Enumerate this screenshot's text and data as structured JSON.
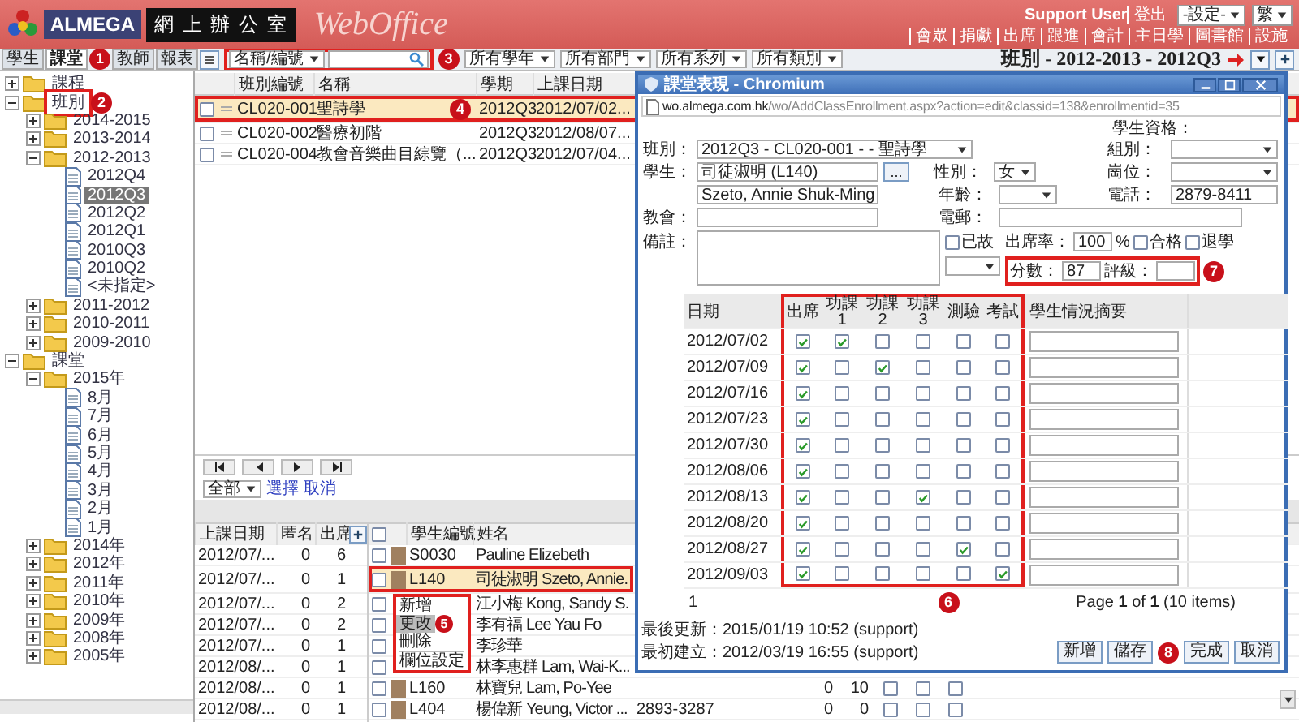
{
  "header": {
    "logo_text": "ALMEGA",
    "title": "網 上 辦 公 室",
    "product": "WebOffice",
    "user": "Support User",
    "logout": "登出",
    "nav": [
      "會眾",
      "捐獻",
      "出席",
      "跟進",
      "會計",
      "主日學",
      "圖書館",
      "設施"
    ],
    "settings_select": "-設定-",
    "language_select": "繁"
  },
  "tabs": [
    {
      "label": "學生",
      "selected": false
    },
    {
      "label": "課堂",
      "selected": true,
      "marker": {
        "number": "1",
        "boxed": false
      }
    },
    {
      "label": "教師",
      "selected": false
    },
    {
      "label": "報表",
      "selected": false
    }
  ],
  "toolbar": {
    "search_by": "名稱/編號",
    "search_marker": {
      "number": "3",
      "boxed": true
    },
    "filters": [
      "所有學年",
      "所有部門",
      "所有系列",
      "所有類別"
    ],
    "context_title": "班別 - 2012-2013 - 2012Q3"
  },
  "tree": [
    {
      "label": "課程",
      "kind": "folder",
      "expanded": false,
      "selected": false
    },
    {
      "label": "班別",
      "kind": "folder",
      "expanded": true,
      "selected": false,
      "marker": {
        "number": "2",
        "boxed": true
      },
      "children": [
        {
          "label": "2014-2015",
          "kind": "folder",
          "expanded": false,
          "selected": false
        },
        {
          "label": "2013-2014",
          "kind": "folder",
          "expanded": false,
          "selected": false
        },
        {
          "label": "2012-2013",
          "kind": "folder",
          "expanded": true,
          "selected": false,
          "children": [
            {
              "label": "2012Q4",
              "kind": "page",
              "selected": false
            },
            {
              "label": "2012Q3",
              "kind": "page",
              "selected": true
            },
            {
              "label": "2012Q2",
              "kind": "page",
              "selected": false
            },
            {
              "label": "2012Q1",
              "kind": "page",
              "selected": false
            },
            {
              "label": "2010Q3",
              "kind": "page",
              "selected": false
            },
            {
              "label": "2010Q2",
              "kind": "page",
              "selected": false
            },
            {
              "label": "<未指定>",
              "kind": "page",
              "selected": false
            }
          ]
        },
        {
          "label": "2011-2012",
          "kind": "folder",
          "expanded": false,
          "selected": false
        },
        {
          "label": "2010-2011",
          "kind": "folder",
          "expanded": false,
          "selected": false
        },
        {
          "label": "2009-2010",
          "kind": "folder",
          "expanded": false,
          "selected": false
        }
      ]
    },
    {
      "label": "課堂",
      "kind": "folder",
      "expanded": true,
      "selected": false,
      "children": [
        {
          "label": "2015年",
          "kind": "folder",
          "expanded": true,
          "selected": false,
          "children": [
            {
              "label": "8月",
              "kind": "page",
              "selected": false
            },
            {
              "label": "7月",
              "kind": "page",
              "selected": false
            },
            {
              "label": "6月",
              "kind": "page",
              "selected": false
            },
            {
              "label": "5月",
              "kind": "page",
              "selected": false
            },
            {
              "label": "4月",
              "kind": "page",
              "selected": false
            },
            {
              "label": "3月",
              "kind": "page",
              "selected": false
            },
            {
              "label": "2月",
              "kind": "page",
              "selected": false
            },
            {
              "label": "1月",
              "kind": "page",
              "selected": false
            }
          ]
        },
        {
          "label": "2014年",
          "kind": "folder",
          "expanded": false,
          "selected": false
        },
        {
          "label": "2012年",
          "kind": "folder",
          "expanded": false,
          "selected": false
        },
        {
          "label": "2011年",
          "kind": "folder",
          "expanded": false,
          "selected": false
        },
        {
          "label": "2010年",
          "kind": "folder",
          "expanded": false,
          "selected": false
        },
        {
          "label": "2009年",
          "kind": "folder",
          "expanded": false,
          "selected": false
        },
        {
          "label": "2008年",
          "kind": "folder",
          "expanded": false,
          "selected": false
        },
        {
          "label": "2005年",
          "kind": "folder",
          "expanded": false,
          "selected": false
        }
      ]
    }
  ],
  "class_table": {
    "columns": [
      "班別編號",
      "名稱",
      "學期",
      "上課日期"
    ],
    "rows": [
      {
        "selected": true,
        "checked": false,
        "marker": {
          "number": "4",
          "boxed": true
        },
        "cells": [
          "CL020-001",
          "聖詩學",
          "2012Q3",
          "2012/07/02..."
        ]
      },
      {
        "selected": false,
        "checked": false,
        "cells": [
          "CL020-002",
          "醫療初階",
          "2012Q3",
          "2012/08/07..."
        ]
      },
      {
        "selected": false,
        "checked": false,
        "cells": [
          "CL020-004",
          "教會音樂曲目綜覽（...",
          "2012Q3",
          "2012/07/04..."
        ]
      }
    ]
  },
  "pager": {
    "filter_select": "全部",
    "links": [
      "選擇",
      "取消"
    ]
  },
  "session_table": {
    "columns": [
      "上課日期",
      "匿名",
      "出席"
    ],
    "rows": [
      [
        "2012/07/...",
        "0",
        "6"
      ],
      [
        "2012/07/...",
        "0",
        "1"
      ],
      [
        "2012/07/...",
        "0",
        "2"
      ],
      [
        "2012/07/...",
        "0",
        "2"
      ],
      [
        "2012/07/...",
        "0",
        "1"
      ],
      [
        "2012/08/...",
        "0",
        "1"
      ],
      [
        "2012/08/...",
        "0",
        "1"
      ],
      [
        "2012/08/...",
        "0",
        "1"
      ]
    ]
  },
  "student_table": {
    "header_checked": false,
    "columns": [
      "學生編號",
      "姓名"
    ],
    "rows": [
      {
        "selected": false,
        "boxed": false,
        "checked": false,
        "photo": true,
        "id": "S0030",
        "name": "Pauline Elizebeth"
      },
      {
        "selected": true,
        "boxed": true,
        "checked": false,
        "photo": true,
        "id": "L140",
        "name": "司徒淑明 Szeto, Annie."
      },
      {
        "selected": false,
        "boxed": false,
        "checked": false,
        "photo": false,
        "name": "江小梅 Kong, Sandy S."
      },
      {
        "selected": false,
        "boxed": false,
        "checked": false,
        "photo": false,
        "name": "李有福 Lee Yau Fo"
      },
      {
        "selected": false,
        "boxed": false,
        "checked": false,
        "photo": false,
        "name": "李珍華"
      },
      {
        "selected": false,
        "boxed": false,
        "checked": false,
        "photo": false,
        "name": "林李惠群 Lam, Wai-K..."
      },
      {
        "selected": false,
        "boxed": false,
        "checked": false,
        "photo": true,
        "id": "L160",
        "name": "林寶兒 Lam, Po-Yee",
        "column_5": "0",
        "column_6": "10",
        "checks": [
          false,
          false,
          false
        ]
      },
      {
        "selected": false,
        "boxed": false,
        "checked": false,
        "photo": true,
        "id": "L404",
        "name": "楊偉新 Yeung, Victor ...",
        "phone": "2893-3287",
        "column_5": "0",
        "column_6": "0",
        "checks": [
          false,
          false,
          false
        ]
      }
    ]
  },
  "context_menu": {
    "marker": {
      "number": "5",
      "boxed": true
    },
    "items": [
      {
        "kind": "item",
        "label": "新增",
        "selected": false
      },
      {
        "kind": "item",
        "label": "更改",
        "selected": true
      },
      {
        "kind": "item",
        "label": "刪除",
        "selected": false
      },
      {
        "kind": "separator"
      },
      {
        "kind": "item",
        "label": "欄位設定",
        "selected": false
      }
    ]
  },
  "dialog": {
    "title": "課堂表現 - Chromium",
    "url_host": "wo.almega.com.hk",
    "url_path": "/wo/AddClassEnrollment.aspx?action=edit&classid=138&enrollmentid=35",
    "qualification_label": "學生資格：",
    "class_label": "班別：",
    "class_value": "2012Q3 - CL020-001 - - 聖詩學",
    "group_label": "組別：",
    "student_label": "學生：",
    "student_value": "司徒淑明 (L140)",
    "browse_button": "...",
    "gender_label": "性別：",
    "gender_value": "女",
    "post_label": "崗位：",
    "english_name": "Szeto, Annie Shuk-Ming",
    "age_label": "年齡：",
    "phone_label": "電話：",
    "phone_value": "2879-8411",
    "church_label": "教會：",
    "email_label": "電郵：",
    "remarks_label": "備註：",
    "deceased": {
      "label": "已故",
      "checked": false
    },
    "attendance_label": "出席率：",
    "attendance_value": "100",
    "percent": "%",
    "passed": {
      "label": "合格",
      "checked": false
    },
    "withdrawn": {
      "label": "退學",
      "checked": false
    },
    "score_marker": {
      "number": "7",
      "boxed": true
    },
    "score_label": "分數：",
    "score_value": "87",
    "grade_label": "評級：",
    "table": {
      "marker": {
        "number": "6",
        "boxed": true
      },
      "columns": [
        "日期",
        "出席",
        "功課 1",
        "功課 2",
        "功課 3",
        "測驗",
        "考試",
        "學生情況摘要"
      ],
      "rows": [
        {
          "date": "2012/07/02",
          "checks": [
            true,
            true,
            false,
            false,
            false,
            false
          ]
        },
        {
          "date": "2012/07/09",
          "checks": [
            true,
            false,
            true,
            false,
            false,
            false
          ]
        },
        {
          "date": "2012/07/16",
          "checks": [
            true,
            false,
            false,
            false,
            false,
            false
          ]
        },
        {
          "date": "2012/07/23",
          "checks": [
            true,
            false,
            false,
            false,
            false,
            false
          ]
        },
        {
          "date": "2012/07/30",
          "checks": [
            true,
            false,
            false,
            false,
            false,
            false
          ]
        },
        {
          "date": "2012/08/06",
          "checks": [
            true,
            false,
            false,
            false,
            false,
            false
          ]
        },
        {
          "date": "2012/08/13",
          "checks": [
            true,
            false,
            false,
            true,
            false,
            false
          ]
        },
        {
          "date": "2012/08/20",
          "checks": [
            true,
            false,
            false,
            false,
            false,
            false
          ]
        },
        {
          "date": "2012/08/27",
          "checks": [
            true,
            false,
            false,
            false,
            true,
            false
          ]
        },
        {
          "date": "2012/09/03",
          "checks": [
            true,
            false,
            false,
            false,
            false,
            true
          ]
        }
      ]
    },
    "page_number": "1",
    "page_info": "Page **1** of **1** (10 items)",
    "last_updated": "最後更新：2015/01/19 10:52 (support)",
    "created": "最初建立：2012/03/19 16:55 (support)",
    "buttons": [
      {
        "label": "新增"
      },
      {
        "label": "儲存"
      },
      {
        "label": "完成",
        "marker": {
          "number": "8",
          "boxed": false
        }
      },
      {
        "label": "取消"
      }
    ]
  }
}
